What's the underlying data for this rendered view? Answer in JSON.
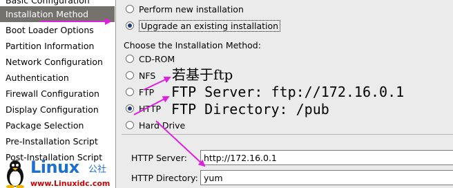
{
  "sidebar": {
    "items": [
      {
        "label": "Basic Configuration"
      },
      {
        "label": "Installation Method",
        "selected": true
      },
      {
        "label": "Boot Loader Options"
      },
      {
        "label": "Partition Information"
      },
      {
        "label": "Network Configuration"
      },
      {
        "label": "Authentication"
      },
      {
        "label": "Firewall Configuration"
      },
      {
        "label": "Display Configuration"
      },
      {
        "label": "Package Selection"
      },
      {
        "label": "Pre-Installation Script"
      },
      {
        "label": "Post-Installation Script"
      }
    ]
  },
  "install_type": {
    "options": [
      {
        "label": "Perform new installation",
        "checked": false
      },
      {
        "label": "Upgrade an existing installation",
        "checked": true
      }
    ]
  },
  "method": {
    "section_label": "Choose the Installation Method:",
    "options": [
      {
        "label": "CD-ROM",
        "checked": false
      },
      {
        "label": "NFS",
        "checked": false
      },
      {
        "label": "FTP",
        "checked": false
      },
      {
        "label": "HTTP",
        "checked": true
      },
      {
        "label": "Hard Drive",
        "checked": false
      }
    ]
  },
  "http": {
    "server_label": "HTTP Server:",
    "server_value": "http://172.16.0.1",
    "directory_label": "HTTP Directory:",
    "directory_value": "yum"
  },
  "annotations": {
    "line1": "若基于ftp",
    "line2": "FTP Server:  ftp://172.16.0.1",
    "line3": "FTP Directory:  /pub",
    "arrow_color": "#e020e0"
  },
  "watermark": {
    "brand": "Linux",
    "brand_cn": "公社",
    "url": "www.Linuxidc.com"
  }
}
